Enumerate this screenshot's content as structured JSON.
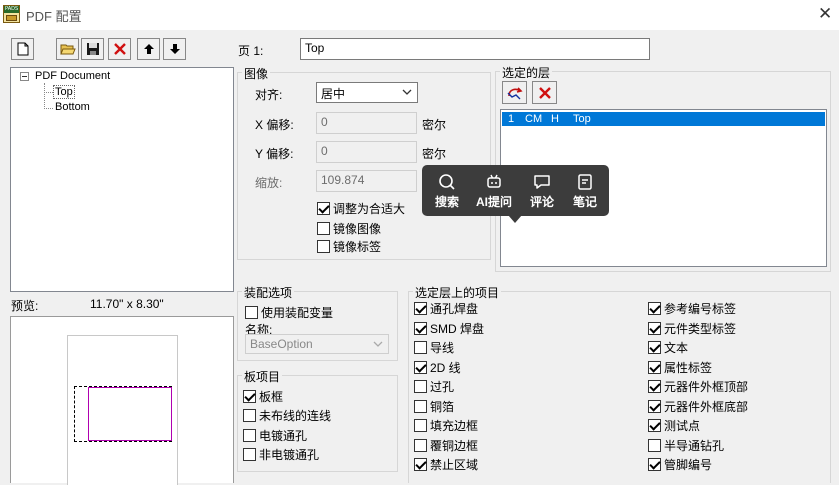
{
  "window": {
    "title": "PDF 配置",
    "app_icon_text": "PADS"
  },
  "toolbar": {
    "buttons": [
      "new-page-icon",
      "open-folder-icon",
      "save-icon",
      "delete-icon",
      "move-up-icon",
      "move-down-icon"
    ]
  },
  "tree": {
    "root": "PDF Document",
    "children": [
      "Top",
      "Bottom"
    ],
    "selected": "Top"
  },
  "page_field": {
    "label": "页 1:",
    "value": "Top"
  },
  "image_group": {
    "title": "图像",
    "align_label": "对齐:",
    "align_value": "居中",
    "x_offset_label": "X 偏移:",
    "x_offset_value": "0",
    "x_unit": "密尔",
    "y_offset_label": "Y 偏移:",
    "y_offset_value": "0",
    "y_unit": "密尔",
    "scale_label": "缩放:",
    "scale_value": "109.874",
    "fit_label": "调整为合适大",
    "fit_checked": true,
    "mirror_image_label": "镜像图像",
    "mirror_image_checked": false,
    "mirror_label_label": "镜像标签",
    "mirror_label_checked": false
  },
  "selected_layers": {
    "title": "选定的层",
    "rows": [
      {
        "num": "1",
        "name": "CM",
        "mode": "H",
        "layer": "Top"
      }
    ]
  },
  "preview": {
    "label": "预览:",
    "size": "11.70\" x  8.30\""
  },
  "assembly": {
    "title": "装配选项",
    "use_variant_label": "使用装配变量",
    "use_variant_checked": false,
    "name_label": "名称:",
    "name_value": "BaseOption"
  },
  "board_items": {
    "title": "板项目",
    "items": [
      {
        "label": "板框",
        "checked": true
      },
      {
        "label": "未布线的连线",
        "checked": false
      },
      {
        "label": "电镀通孔",
        "checked": false
      },
      {
        "label": "非电镀通孔",
        "checked": false
      }
    ]
  },
  "layer_items": {
    "title": "选定层上的项目",
    "left": [
      {
        "label": "通孔焊盘",
        "checked": true
      },
      {
        "label": "SMD 焊盘",
        "checked": true
      },
      {
        "label": "导线",
        "checked": false
      },
      {
        "label": "2D 线",
        "checked": true
      },
      {
        "label": "过孔",
        "checked": false
      },
      {
        "label": "铜箔",
        "checked": false
      },
      {
        "label": "填充边框",
        "checked": false
      },
      {
        "label": "覆铜边框",
        "checked": false
      },
      {
        "label": "禁止区域",
        "checked": true
      }
    ],
    "right": [
      {
        "label": "参考编号标签",
        "checked": true
      },
      {
        "label": "元件类型标签",
        "checked": true
      },
      {
        "label": "文本",
        "checked": true
      },
      {
        "label": "属性标签",
        "checked": true
      },
      {
        "label": "元器件外框顶部",
        "checked": true
      },
      {
        "label": "元器件外框底部",
        "checked": true
      },
      {
        "label": "测试点",
        "checked": true
      },
      {
        "label": "半导通钻孔",
        "checked": false
      },
      {
        "label": "管脚编号",
        "checked": true
      }
    ]
  },
  "popup": {
    "items": [
      {
        "label": "搜索",
        "icon": "search-icon"
      },
      {
        "label": "AI提问",
        "icon": "ai-robot-icon"
      },
      {
        "label": "评论",
        "icon": "comment-icon"
      },
      {
        "label": "笔记",
        "icon": "note-icon"
      }
    ]
  }
}
